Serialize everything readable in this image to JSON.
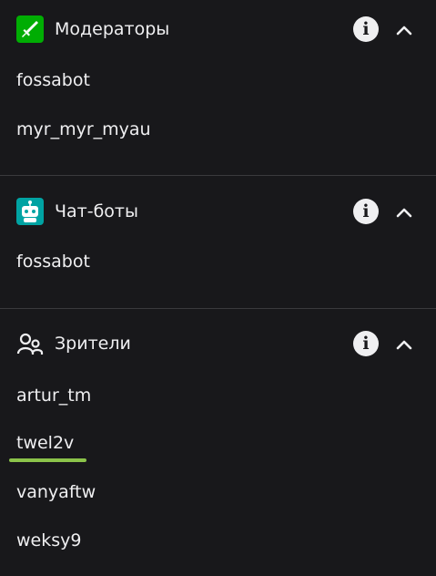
{
  "moderators": {
    "title": "Модераторы",
    "icon": "sword-icon",
    "icon_color": "#00ad03",
    "users": [
      "fossabot",
      "myr_myr_myau"
    ]
  },
  "chatbots": {
    "title": "Чат-боты",
    "icon": "robot-icon",
    "icon_color": "#00a3a3",
    "users": [
      "fossabot"
    ]
  },
  "viewers": {
    "title": "Зрители",
    "icon": "viewers-icon",
    "users": [
      "artur_tm",
      "twel2v",
      "vanyaftw",
      "weksy9"
    ]
  },
  "colors": {
    "background": "#18181b",
    "text": "#efeff1",
    "divider": "#3a3a3d",
    "highlight_underline": "#8bc34a"
  }
}
